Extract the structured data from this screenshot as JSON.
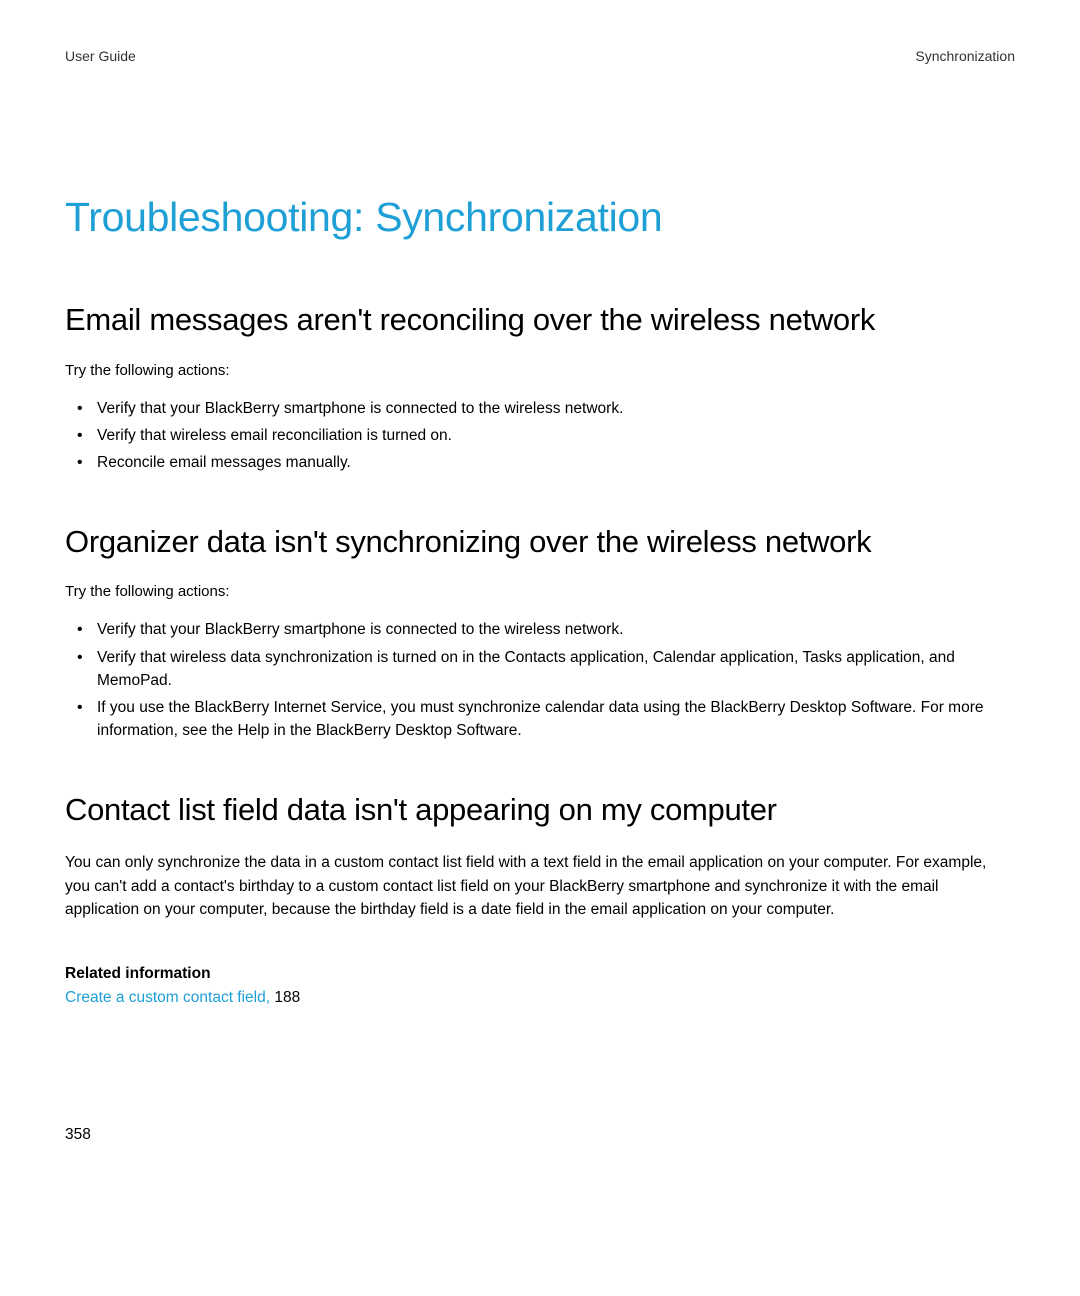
{
  "header": {
    "left": "User Guide",
    "right": "Synchronization"
  },
  "title": "Troubleshooting: Synchronization",
  "sections": [
    {
      "heading": "Email messages aren't reconciling over the wireless network",
      "intro": "Try the following actions:",
      "bullets": [
        "Verify that your BlackBerry smartphone is connected to the wireless network.",
        "Verify that wireless email reconciliation is turned on.",
        "Reconcile email messages manually."
      ]
    },
    {
      "heading": "Organizer data isn't synchronizing over the wireless network",
      "intro": "Try the following actions:",
      "bullets": [
        "Verify that your BlackBerry smartphone is connected to the wireless network.",
        "Verify that wireless data synchronization is turned on in the Contacts application, Calendar application, Tasks application, and MemoPad.",
        "If you use the BlackBerry Internet Service, you must synchronize calendar data using the BlackBerry Desktop Software. For more information, see the Help in the BlackBerry Desktop Software."
      ]
    },
    {
      "heading": "Contact list field data isn't appearing on my computer",
      "body": "You can only synchronize the data in a custom contact list field with a text field in the email application on your computer. For example, you can't add a contact's birthday to a custom contact list field on your BlackBerry smartphone and synchronize it with the email application on your computer, because the birthday field is a date field in the email application on your computer."
    }
  ],
  "related": {
    "heading": "Related information",
    "link_text": "Create a custom contact field,",
    "page_ref": " 188"
  },
  "page_number": "358"
}
